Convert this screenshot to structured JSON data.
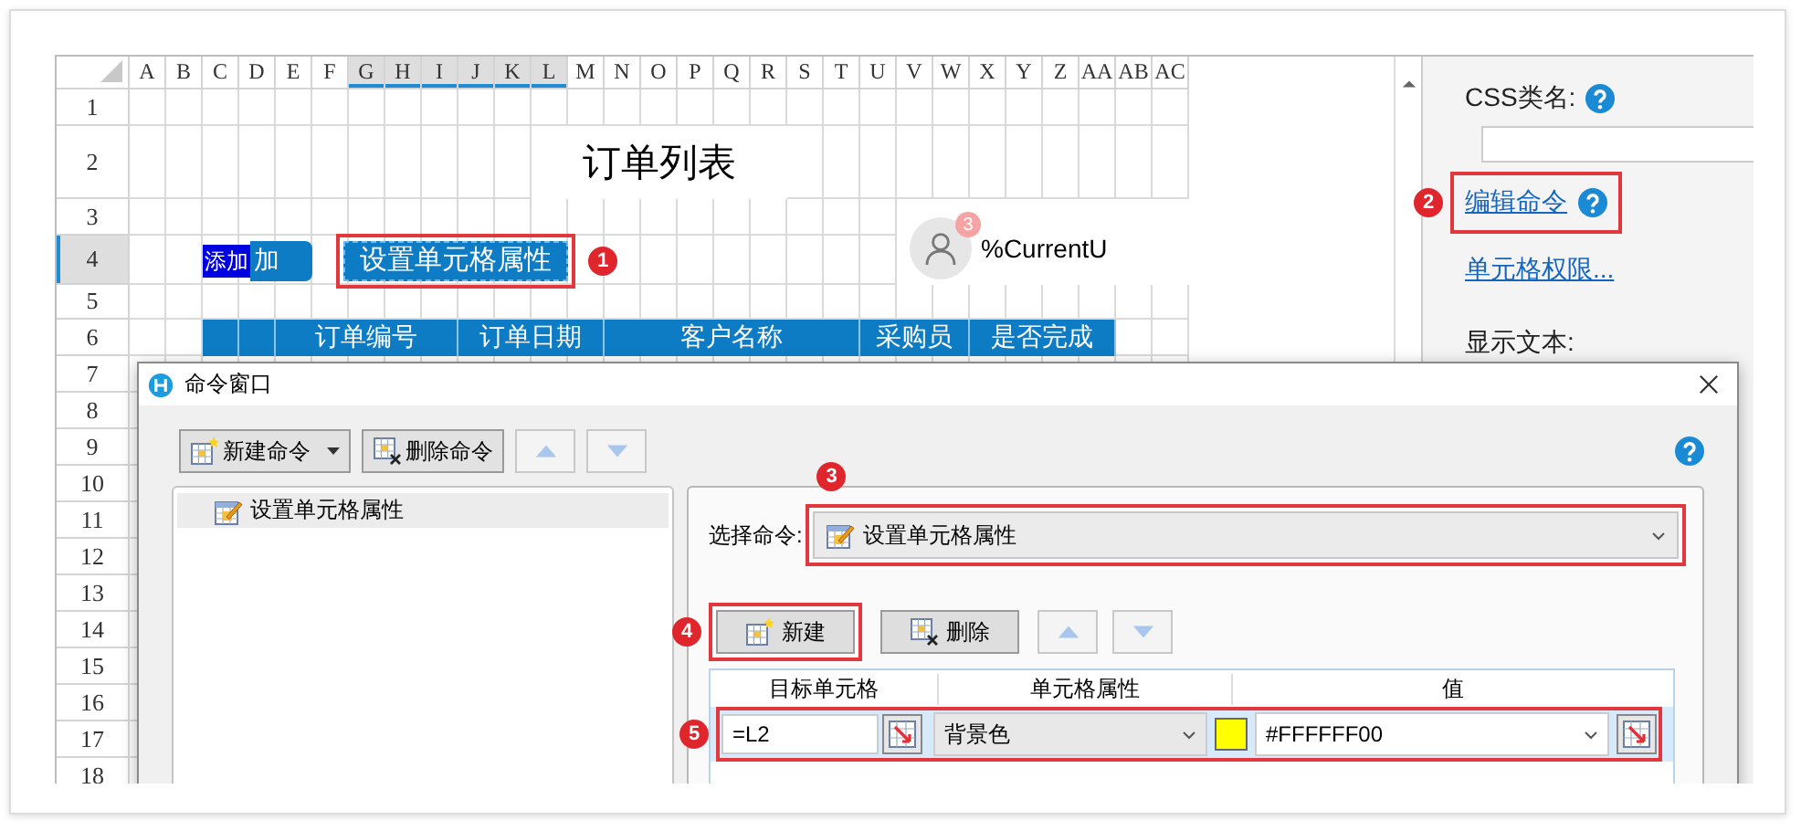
{
  "sheet": {
    "columns": [
      {
        "label": "A",
        "selected": false
      },
      {
        "label": "B",
        "selected": false
      },
      {
        "label": "C",
        "selected": false
      },
      {
        "label": "D",
        "selected": false
      },
      {
        "label": "E",
        "selected": false
      },
      {
        "label": "F",
        "selected": false
      },
      {
        "label": "G",
        "selected": true
      },
      {
        "label": "H",
        "selected": true
      },
      {
        "label": "I",
        "selected": true
      },
      {
        "label": "J",
        "selected": true
      },
      {
        "label": "K",
        "selected": true
      },
      {
        "label": "L",
        "selected": true
      },
      {
        "label": "M",
        "selected": false
      },
      {
        "label": "N",
        "selected": false
      },
      {
        "label": "O",
        "selected": false
      },
      {
        "label": "P",
        "selected": false
      },
      {
        "label": "Q",
        "selected": false
      },
      {
        "label": "R",
        "selected": false
      },
      {
        "label": "S",
        "selected": false
      },
      {
        "label": "T",
        "selected": false
      },
      {
        "label": "U",
        "selected": false
      },
      {
        "label": "V",
        "selected": false
      },
      {
        "label": "W",
        "selected": false
      },
      {
        "label": "X",
        "selected": false
      },
      {
        "label": "Y",
        "selected": false
      },
      {
        "label": "Z",
        "selected": false
      },
      {
        "label": "AA",
        "selected": false
      },
      {
        "label": "AB",
        "selected": false
      },
      {
        "label": "AC",
        "selected": false
      }
    ],
    "rows": [
      {
        "label": "1",
        "selected": false
      },
      {
        "label": "2",
        "selected": false
      },
      {
        "label": "3",
        "selected": false
      },
      {
        "label": "4",
        "selected": true
      },
      {
        "label": "5",
        "selected": false
      },
      {
        "label": "6",
        "selected": false
      },
      {
        "label": "7",
        "selected": false
      },
      {
        "label": "8",
        "selected": false
      },
      {
        "label": "9",
        "selected": false
      },
      {
        "label": "10",
        "selected": false
      },
      {
        "label": "11",
        "selected": false
      },
      {
        "label": "12",
        "selected": false
      },
      {
        "label": "13",
        "selected": false
      },
      {
        "label": "14",
        "selected": false
      },
      {
        "label": "15",
        "selected": false
      },
      {
        "label": "16",
        "selected": false
      },
      {
        "label": "17",
        "selected": false
      },
      {
        "label": "18",
        "selected": false
      }
    ],
    "title": "订单列表",
    "add_button": {
      "label": "加",
      "tag": "添加"
    },
    "action_button": {
      "label": "设置单元格属性",
      "callout": "1"
    },
    "user": {
      "badge": "3",
      "name": "%CurrentU"
    },
    "table_header": [
      "订单编号",
      "订单日期",
      "客户名称",
      "采购员",
      "是否完成"
    ]
  },
  "properties": {
    "css_class_label": "CSS类名:",
    "edit_command_link": {
      "label": "编辑命令",
      "callout": "2"
    },
    "permission_link": "单元格权限...",
    "display_text_label": "显示文本:"
  },
  "dialog": {
    "title": "命令窗口",
    "toolbar": [
      {
        "kind": "new",
        "label": "新建命令"
      },
      {
        "kind": "delete",
        "label": "删除命令"
      },
      {
        "kind": "up"
      },
      {
        "kind": "down"
      }
    ],
    "commands": [
      {
        "label": "设置单元格属性",
        "selected": true
      }
    ],
    "command_select": {
      "label": "选择命令:",
      "value": "设置单元格属性",
      "callout": "3"
    },
    "buttons": [
      {
        "kind": "new",
        "label": "新建",
        "callout": "4"
      },
      {
        "kind": "delete",
        "label": "删除"
      },
      {
        "kind": "up"
      },
      {
        "kind": "down"
      }
    ],
    "table": {
      "columns": [
        "目标单元格",
        "单元格属性",
        "值"
      ],
      "rows": [
        {
          "target": "=L2",
          "property": "背景色",
          "color": "#ffff00",
          "value": "#FFFFFF00",
          "selected": true,
          "callout": "5"
        }
      ]
    }
  }
}
